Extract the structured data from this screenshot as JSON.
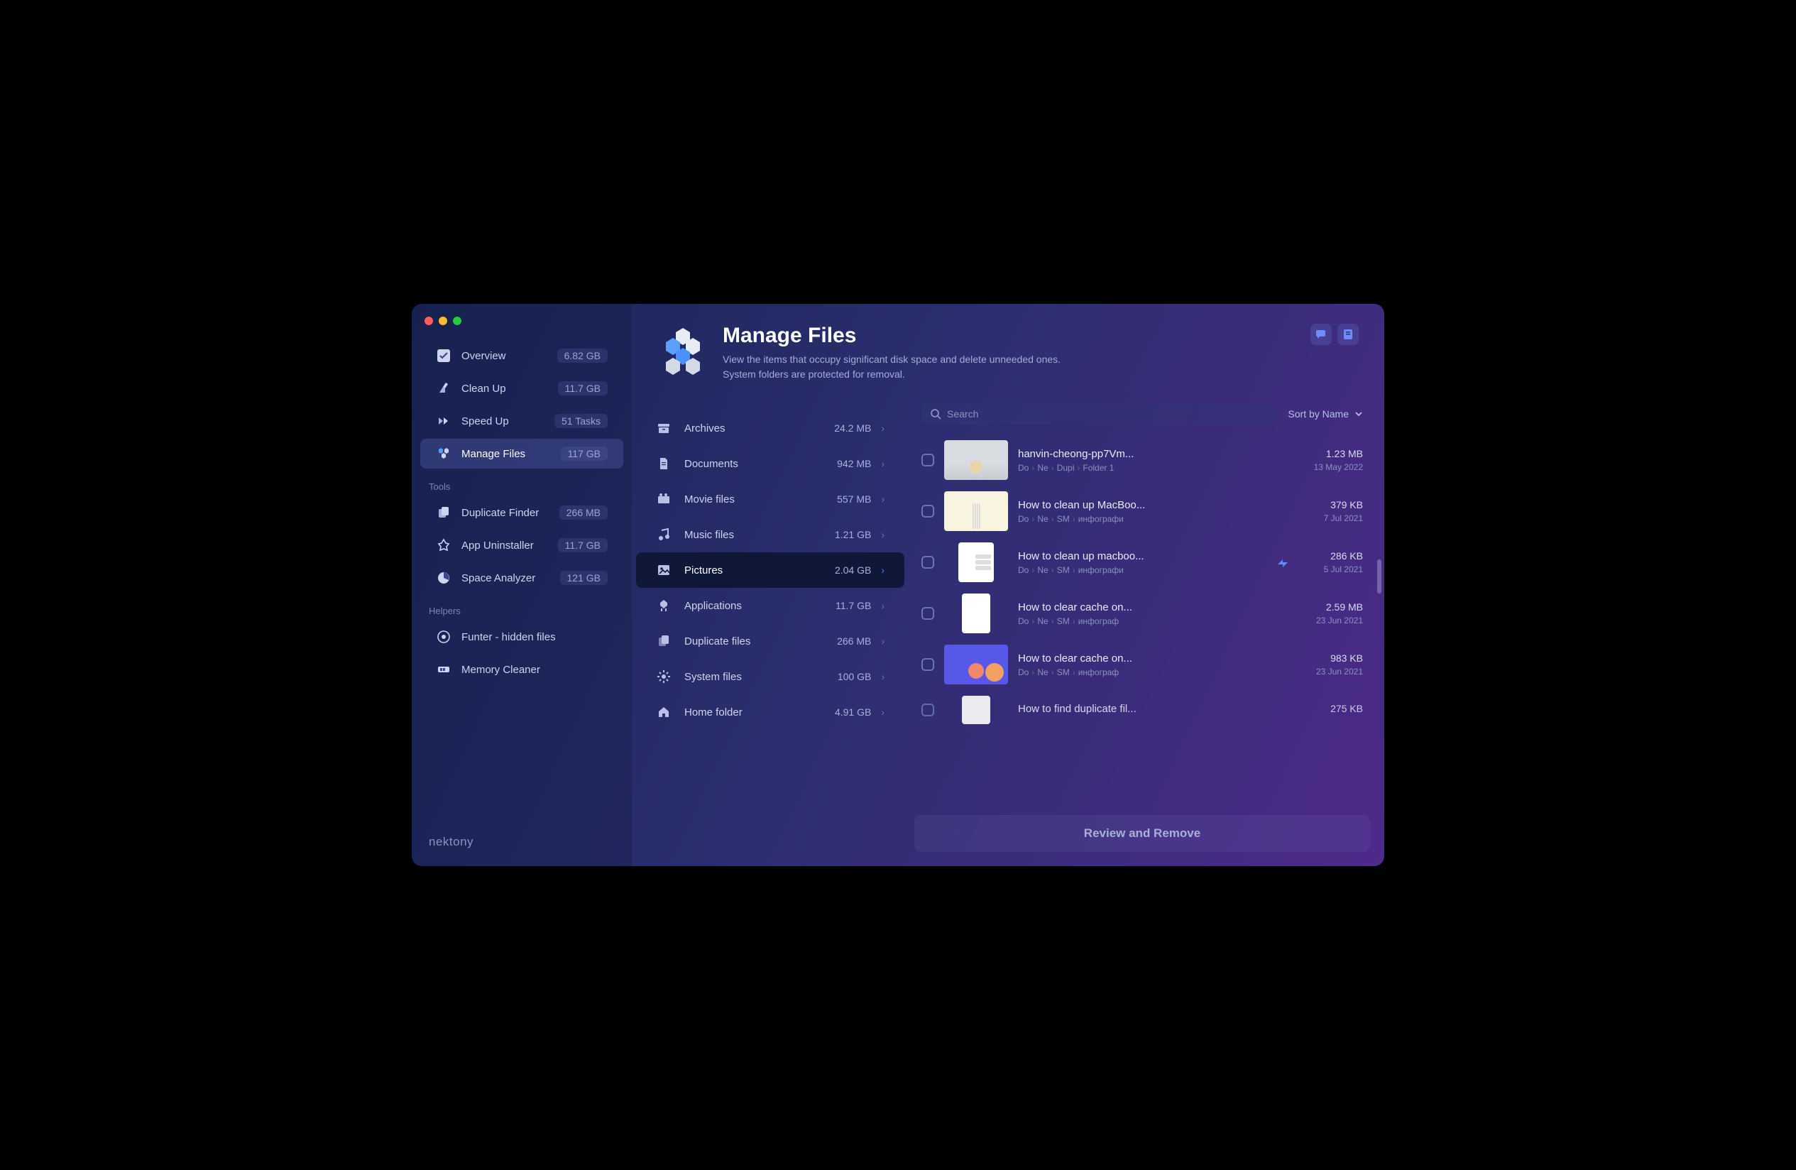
{
  "brand": "nektony",
  "header": {
    "title": "Manage Files",
    "desc_line1": "View the items that occupy significant disk space and delete unneeded ones.",
    "desc_line2": "System folders are protected for removal."
  },
  "sidebar": {
    "main": [
      {
        "icon": "overview",
        "label": "Overview",
        "value": "6.82 GB"
      },
      {
        "icon": "cleanup",
        "label": "Clean Up",
        "value": "11.7 GB"
      },
      {
        "icon": "speedup",
        "label": "Speed Up",
        "value": "51 Tasks"
      },
      {
        "icon": "manage",
        "label": "Manage Files",
        "value": "117 GB"
      }
    ],
    "tools_label": "Tools",
    "tools": [
      {
        "icon": "duplicate",
        "label": "Duplicate Finder",
        "value": "266 MB"
      },
      {
        "icon": "uninstall",
        "label": "App Uninstaller",
        "value": "11.7 GB"
      },
      {
        "icon": "analyzer",
        "label": "Space Analyzer",
        "value": "121 GB"
      }
    ],
    "helpers_label": "Helpers",
    "helpers": [
      {
        "icon": "funter",
        "label": "Funter - hidden files",
        "value": ""
      },
      {
        "icon": "memory",
        "label": "Memory Cleaner",
        "value": ""
      }
    ]
  },
  "categories": [
    {
      "icon": "archive",
      "label": "Archives",
      "size": "24.2 MB"
    },
    {
      "icon": "document",
      "label": "Documents",
      "size": "942 MB"
    },
    {
      "icon": "movie",
      "label": "Movie files",
      "size": "557 MB"
    },
    {
      "icon": "music",
      "label": "Music files",
      "size": "1.21 GB"
    },
    {
      "icon": "picture",
      "label": "Pictures",
      "size": "2.04 GB"
    },
    {
      "icon": "app",
      "label": "Applications",
      "size": "11.7 GB"
    },
    {
      "icon": "dupfiles",
      "label": "Duplicate files",
      "size": "266 MB"
    },
    {
      "icon": "system",
      "label": "System files",
      "size": "100 GB"
    },
    {
      "icon": "home",
      "label": "Home folder",
      "size": "4.91 GB"
    }
  ],
  "active_category_index": 4,
  "toolbar": {
    "search_placeholder": "Search",
    "sort_label": "Sort by Name"
  },
  "files": [
    {
      "name": "hanvin-cheong-pp7Vm...",
      "path": [
        "Do",
        "Ne",
        "Dupl",
        "Folder 1"
      ],
      "size": "1.23 MB",
      "date": "13 May 2022",
      "thumb": "t1"
    },
    {
      "name": "How to clean up MacBoo...",
      "path": [
        "Do",
        "Ne",
        "SM",
        "инфографи"
      ],
      "size": "379 KB",
      "date": "7 Jul 2021",
      "thumb": "t2"
    },
    {
      "name": "How to clean up macboo...",
      "path": [
        "Do",
        "Ne",
        "SM",
        "инфографи"
      ],
      "size": "286 KB",
      "date": "5 Jul 2021",
      "thumb": "t3",
      "cloud": true
    },
    {
      "name": "How to clear cache on...",
      "path": [
        "Do",
        "Ne",
        "SM",
        "инфограф"
      ],
      "size": "2.59 MB",
      "date": "23 Jun 2021",
      "thumb": "t4"
    },
    {
      "name": "How to clear cache on...",
      "path": [
        "Do",
        "Ne",
        "SM",
        "инфограф"
      ],
      "size": "983 KB",
      "date": "23 Jun 2021",
      "thumb": "t5"
    },
    {
      "name": "How to find duplicate fil...",
      "path": [],
      "size": "275 KB",
      "date": "",
      "thumb": "t6"
    }
  ],
  "footer_button": "Review and Remove"
}
